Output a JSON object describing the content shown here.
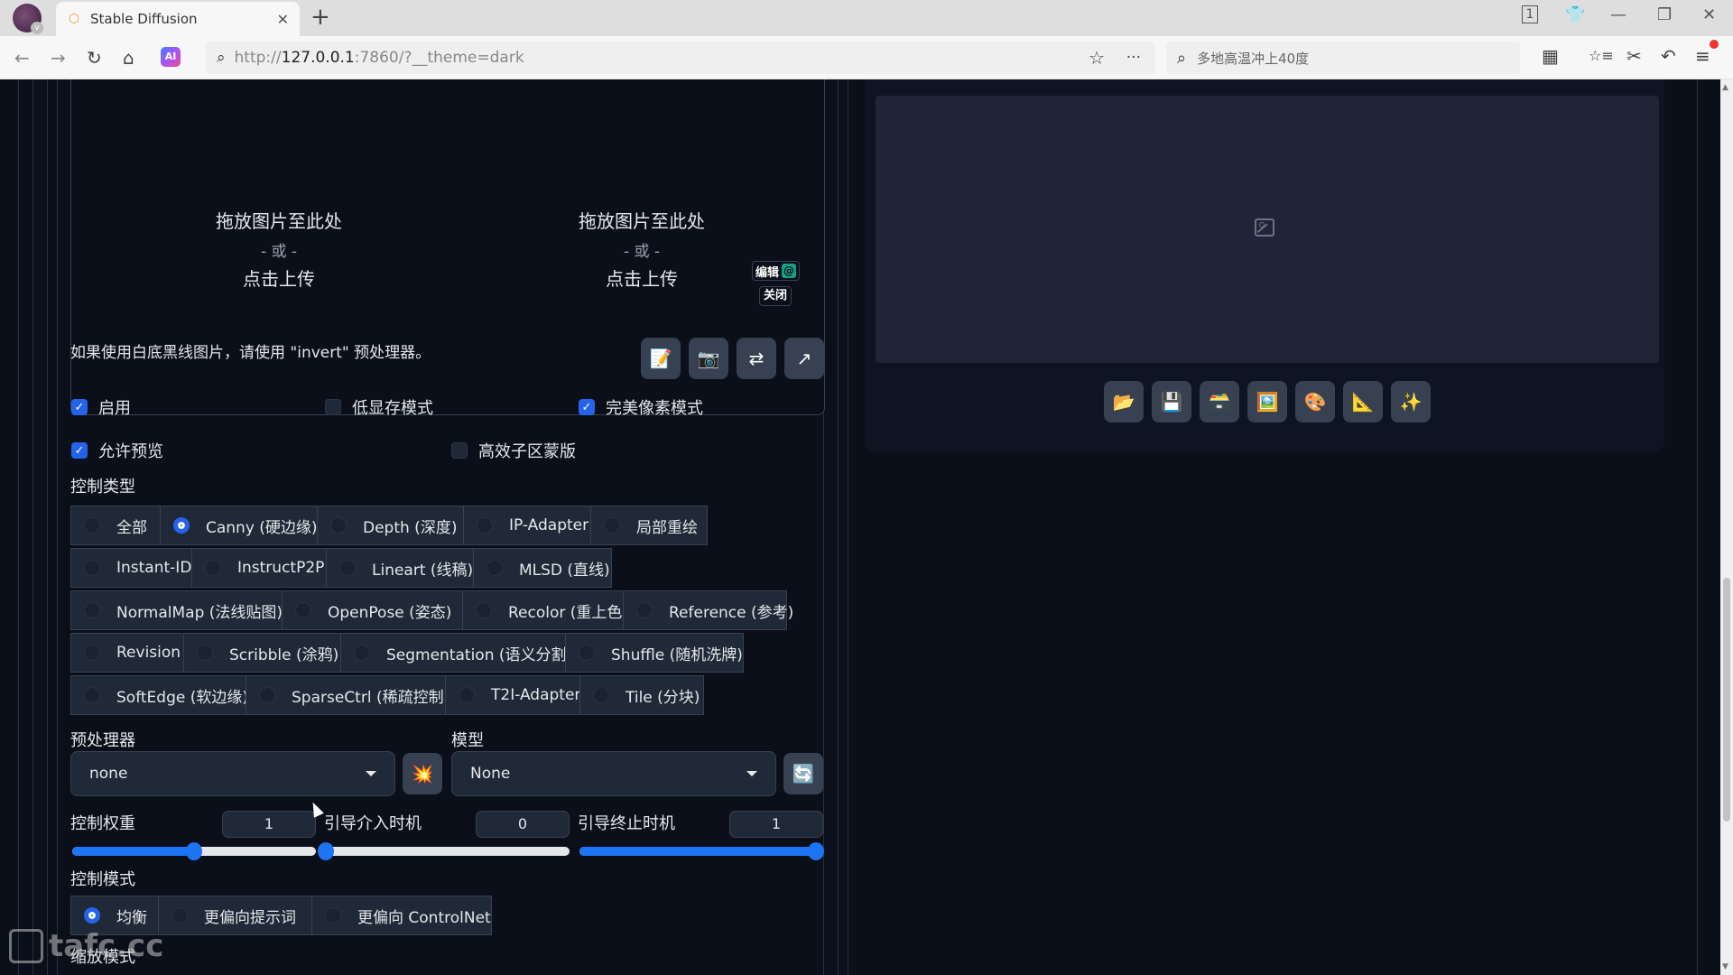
{
  "browser": {
    "tab_title": "Stable Diffusion",
    "tab_count": "1",
    "url_prefix": "http://",
    "url_host": "127.0.0.1",
    "url_rest": ":7860/?__theme=dark",
    "search_placeholder": "多地高温冲上40度",
    "icons": {
      "back": "←",
      "forward": "→",
      "reload": "↻",
      "home": "⌂",
      "ai": "AI",
      "search": "🔍",
      "star": "☆",
      "more": "···",
      "apps": "▦",
      "favorites": "☆≡",
      "cut": "✂",
      "undo": "↶",
      "menu": "≡",
      "minimize": "—",
      "restore": "❐",
      "close": "✕",
      "skin": "👕",
      "new_tab": "+",
      "tab_close": "✕"
    }
  },
  "upload": {
    "left": {
      "line1": "拖放图片至此处",
      "line2": "- 或 -",
      "line3": "点击上传"
    },
    "right": {
      "line1": "拖放图片至此处",
      "line2": "- 或 -",
      "line3": "点击上传"
    },
    "edit_label": "编辑",
    "close_label": "关闭"
  },
  "hint": "如果使用白底黑线图片，请使用 \"invert\" 预处理器。",
  "tool_buttons": [
    "📝",
    "📷",
    "⇄",
    "↗"
  ],
  "checkboxes": {
    "enable": {
      "label": "启用",
      "checked": true
    },
    "low_vram": {
      "label": "低显存模式",
      "checked": false
    },
    "pixel_perfect": {
      "label": "完美像素模式",
      "checked": true
    },
    "allow_preview": {
      "label": "允许预览",
      "checked": true
    },
    "efficient_mask": {
      "label": "高效子区蒙版",
      "checked": false
    }
  },
  "control_type": {
    "label": "控制类型",
    "selected": "Canny (硬边缘)",
    "rows": [
      [
        "全部",
        "Canny (硬边缘)",
        "Depth (深度)",
        "IP-Adapter",
        "局部重绘"
      ],
      [
        "Instant-ID",
        "InstructP2P",
        "Lineart (线稿)",
        "MLSD (直线)"
      ],
      [
        "NormalMap (法线贴图)",
        "OpenPose (姿态)",
        "Recolor (重上色)",
        "Reference (参考)"
      ],
      [
        "Revision",
        "Scribble (涂鸦)",
        "Segmentation (语义分割)",
        "Shuffle (随机洗牌)"
      ],
      [
        "SoftEdge (软边缘)",
        "SparseCtrl (稀疏控制)",
        "T2I-Adapter",
        "Tile (分块)"
      ]
    ]
  },
  "preprocessor": {
    "label": "预处理器",
    "value": "none",
    "run_icon": "💥"
  },
  "model": {
    "label": "模型",
    "value": "None",
    "refresh_icon": "🔄"
  },
  "sliders": {
    "control_weight": {
      "label": "控制权重",
      "value": "1",
      "fraction": 0.5
    },
    "start_step": {
      "label": "引导介入时机",
      "value": "0",
      "fraction": 0.0
    },
    "end_step": {
      "label": "引导终止时机",
      "value": "1",
      "fraction": 1.0
    }
  },
  "control_mode": {
    "label": "控制模式",
    "options": [
      "均衡",
      "更偏向提示词",
      "更偏向 ControlNet"
    ],
    "selected": "均衡"
  },
  "resize_mode": {
    "label": "缩放模式"
  },
  "output_tools": [
    "📂",
    "💾",
    "🗃️",
    "🖼️",
    "🎨",
    "📐",
    "✨"
  ],
  "watermark": "tafc.cc"
}
